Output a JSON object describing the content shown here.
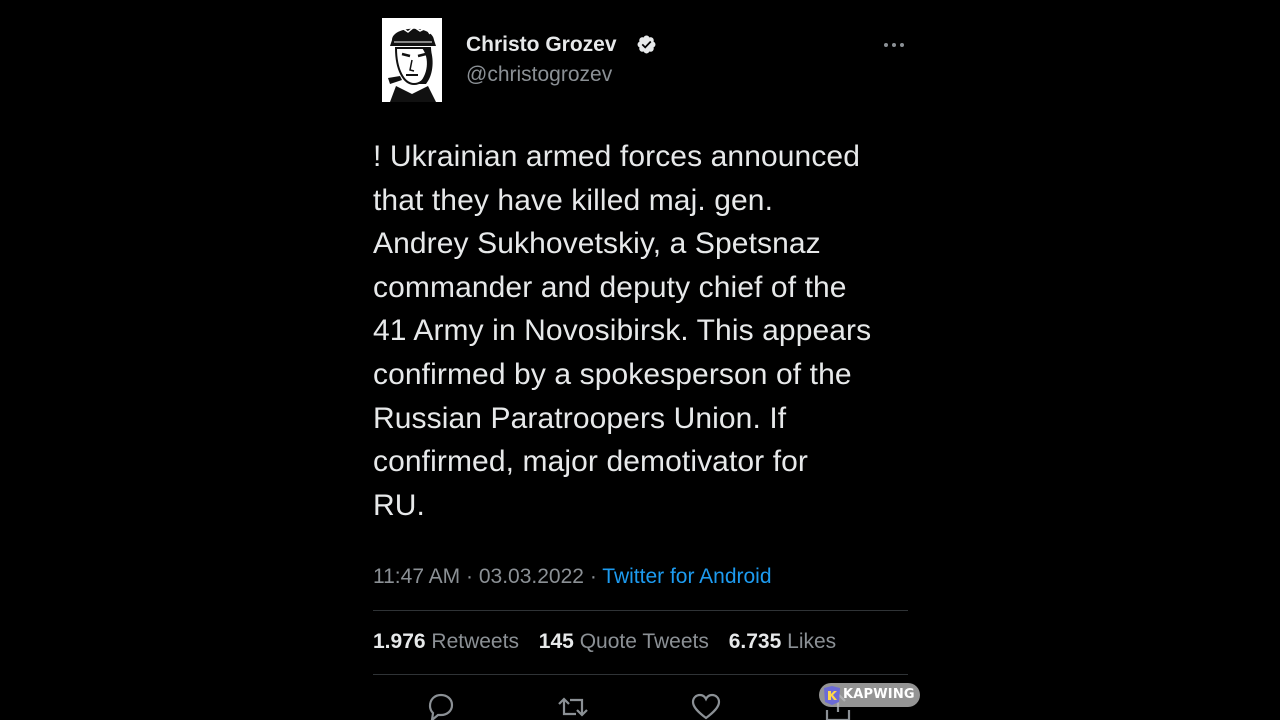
{
  "author": {
    "name": "Christo Grozev",
    "handle": "@christogrozev",
    "verified": true
  },
  "icons": {
    "verified": "verified-badge-icon",
    "more": "more-horizontal-icon",
    "reply": "reply-icon",
    "retweet": "retweet-icon",
    "like": "like-icon",
    "share": "share-icon"
  },
  "tweet": {
    "lines": [
      "! Ukrainian armed forces announced",
      "that they have killed maj. gen.",
      "Andrey Sukhovetskiy, a Spetsnaz",
      "commander and deputy chief of the",
      "41 Army in Novosibirsk. This appears",
      "confirmed by a spokesperson of the",
      "Russian Paratroopers Union. If",
      "confirmed, major demotivator for",
      "RU."
    ],
    "time": "11:47 AM",
    "separator": "·",
    "date": "03.03.2022",
    "source": "Twitter for Android"
  },
  "stats": {
    "retweets_count": "1.976",
    "retweets_label": "Retweets",
    "quotes_count": "145",
    "quotes_label": "Quote Tweets",
    "likes_count": "6.735",
    "likes_label": "Likes"
  },
  "watermark": {
    "text": "KAPWING"
  },
  "colors": {
    "background": "#000000",
    "text": "#e7e9ea",
    "muted": "#8b9095",
    "link": "#1d9bf0",
    "divider": "#2f3336"
  }
}
